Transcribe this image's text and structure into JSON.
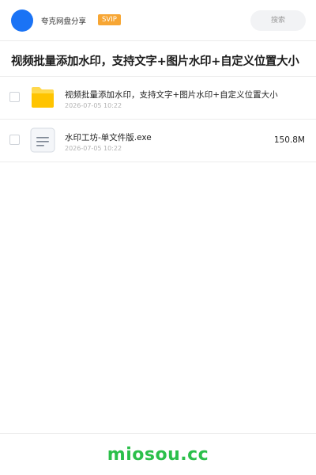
{
  "header": {
    "account_name": "夸克网盘分享",
    "vip_badge": "SVIP",
    "search_label": "搜索"
  },
  "page": {
    "title": "视频批量添加水印，支持文字+图片水印+自定义位置大小"
  },
  "files": [
    {
      "name": "视频批量添加水印，支持文字+图片水印+自定义位置大小",
      "date": "2026-07-05 10:22",
      "size": "",
      "icon": "folder-icon"
    },
    {
      "name": "水印工坊-单文件版.exe",
      "date": "2026-07-05 10:22",
      "size": "150.8M",
      "icon": "document-icon"
    }
  ],
  "footer": {
    "watermark": "miosou.cc"
  },
  "colors": {
    "avatar": "#1a73f5",
    "vip": "#f7a634",
    "folder": "#ffc400",
    "watermark": "#2bbf4a"
  }
}
